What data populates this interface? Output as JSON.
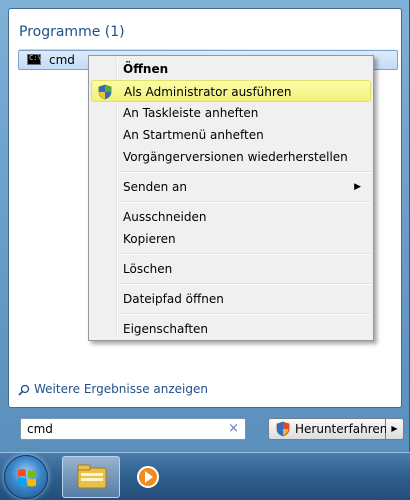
{
  "results": {
    "group_title": "Programme (1)",
    "items": [
      {
        "label": "cmd",
        "icon": "cmd-icon",
        "icon_text": "C:\\"
      }
    ]
  },
  "context_menu": {
    "items": [
      {
        "label": "Öffnen",
        "bold": true
      },
      {
        "label": "Als Administrator ausführen",
        "icon": "shield-icon",
        "highlighted": true
      },
      {
        "label": "An Taskleiste anheften"
      },
      {
        "label": "An Startmenü anheften"
      },
      {
        "label": "Vorgängerversionen wiederherstellen"
      },
      {
        "label": "Senden an",
        "submenu": true
      },
      {
        "label": "Ausschneiden"
      },
      {
        "label": "Kopieren"
      },
      {
        "label": "Löschen"
      },
      {
        "label": "Dateipfad öffnen"
      },
      {
        "label": "Eigenschaften"
      }
    ]
  },
  "more_results": {
    "label": "Weitere Ergebnisse anzeigen"
  },
  "search": {
    "value": "cmd",
    "clear_icon": "×"
  },
  "shutdown": {
    "label": "Herunterfahren",
    "arrow": "▶"
  },
  "taskbar": {
    "items": [
      "start-orb",
      "windows-explorer-icon",
      "media-player-icon"
    ]
  },
  "colors": {
    "highlight": "#f2f27a",
    "link": "#1e4f8a",
    "selection": "#c3dcf7"
  }
}
